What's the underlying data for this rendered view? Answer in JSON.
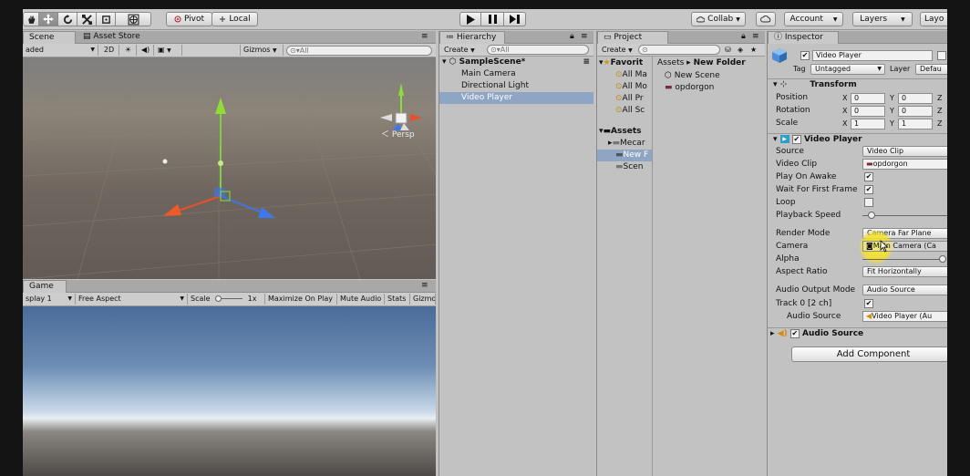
{
  "toolbar": {
    "pivot": "Pivot",
    "local": "Local",
    "collab": "Collab",
    "account": "Account",
    "layers": "Layers",
    "layout": "Layo"
  },
  "scene": {
    "tabs": [
      "Scene",
      "Asset Store"
    ],
    "shading": "aded",
    "mode2d": "2D",
    "gizmos": "Gizmos",
    "search": "All",
    "persp": "Persp"
  },
  "game": {
    "tab": "Game",
    "display": "splay 1",
    "aspect": "Free Aspect",
    "scale_label": "Scale",
    "scale_value": "1x",
    "maximize": "Maximize On Play",
    "mute": "Mute Audio",
    "stats": "Stats",
    "gizmos": "Gizmo"
  },
  "hierarchy": {
    "tab": "Hierarchy",
    "create": "Create",
    "search": "All",
    "scene": "SampleScene*",
    "items": [
      "Main Camera",
      "Directional Light",
      "Video Player"
    ]
  },
  "project": {
    "tab": "Project",
    "create": "Create",
    "favorites": "Favorit",
    "fav_items": [
      "All Ma",
      "All Mo",
      "All Pr",
      "All Sc"
    ],
    "assets": "Assets",
    "asset_items": [
      "Mecar",
      "New F",
      "Scen"
    ],
    "breadcrumb": [
      "Assets",
      "New Folder"
    ],
    "files": [
      "New Scene",
      "opdorgon"
    ]
  },
  "inspector": {
    "tab": "Inspector",
    "object_name": "Video Player",
    "static": "",
    "tag_label": "Tag",
    "tag": "Untagged",
    "layer_label": "Layer",
    "layer": "Defau",
    "transform": {
      "title": "Transform",
      "rows": [
        {
          "label": "Position",
          "x": "0",
          "y": "0"
        },
        {
          "label": "Rotation",
          "x": "0",
          "y": "0"
        },
        {
          "label": "Scale",
          "x": "1",
          "y": "1"
        }
      ],
      "z_label": "Z"
    },
    "video_player": {
      "title": "Video Player",
      "source_label": "Source",
      "source": "Video Clip",
      "clip_label": "Video Clip",
      "clip": "opdorgon",
      "play_on_awake": "Play On Awake",
      "wait_first_frame": "Wait For First Frame",
      "loop": "Loop",
      "playback_speed": "Playback Speed",
      "render_mode_label": "Render Mode",
      "render_mode": "Camera Far Plane",
      "camera_label": "Camera",
      "camera": "Main Camera (Ca",
      "alpha": "Alpha",
      "aspect_ratio_label": "Aspect Ratio",
      "aspect_ratio": "Fit Horizontally",
      "audio_output_label": "Audio Output Mode",
      "audio_output": "Audio Source",
      "track": "Track 0 [2 ch]",
      "audio_source_label": "Audio Source",
      "audio_source": "Video Player (Au"
    },
    "audio_source_component": "Audio Source",
    "add_component": "Add Component"
  },
  "colors": {
    "accent": "#3d6ba8",
    "selection": "#8fa5c4",
    "highlight": "#f5e52a"
  }
}
